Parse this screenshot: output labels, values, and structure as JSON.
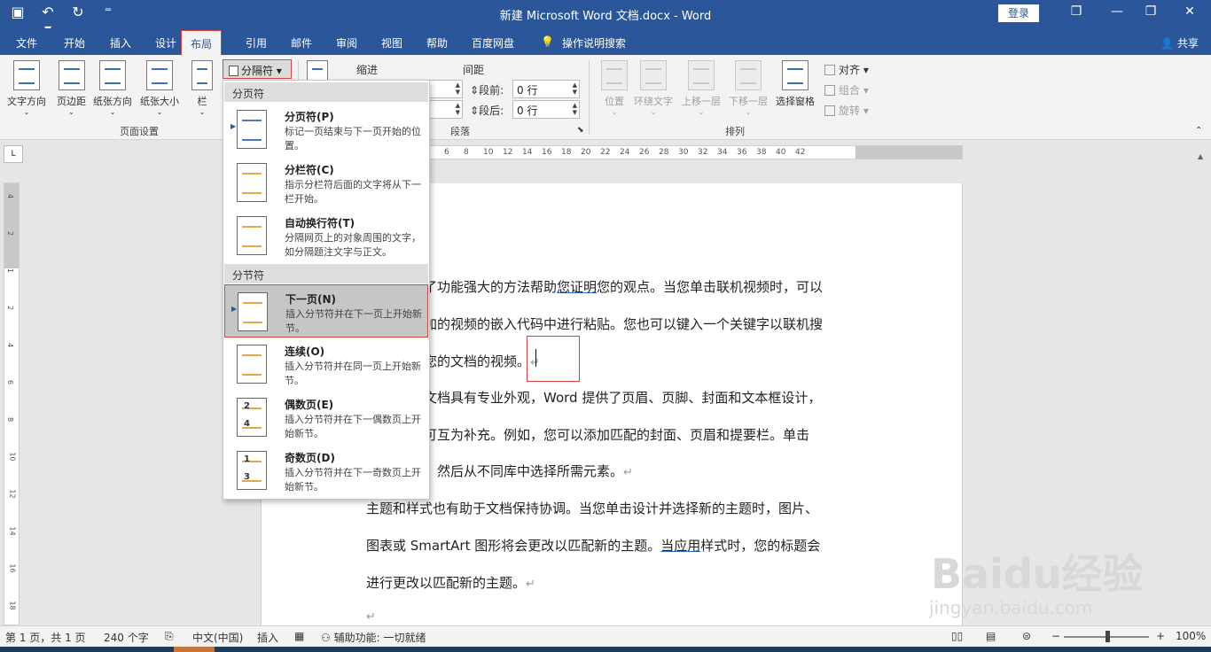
{
  "titlebar": {
    "title": "新建 Microsoft Word 文档.docx  -  Word",
    "login": "登录",
    "qat_icons": [
      "save-icon",
      "undo-icon",
      "redo-icon",
      "customize-icon"
    ],
    "save_glyph": "▣",
    "undo_glyph": "↶ ▾",
    "redo_glyph": "↻",
    "customize_glyph": "⁼",
    "restore_glyph": "❐",
    "minimize_glyph": "—",
    "maximize_glyph": "❐",
    "close_glyph": "✕"
  },
  "tabs": [
    "文件",
    "开始",
    "插入",
    "设计",
    "布局",
    "引用",
    "邮件",
    "审阅",
    "视图",
    "帮助",
    "百度网盘",
    "操作说明搜索"
  ],
  "active_tab": "布局",
  "share": "共享",
  "ribbon": {
    "page_setup": {
      "text_direction": "文字方向",
      "margins": "页边距",
      "orientation": "纸张方向",
      "size": "纸张大小",
      "columns": "栏",
      "breaks": "分隔符 ▾",
      "group_label": "页面设置"
    },
    "paragraph": {
      "indent_label": "缩进",
      "spacing_label": "间距",
      "before_label": "段前:",
      "after_label": "段后:",
      "before_value": "0 行",
      "after_value": "0 行",
      "group_label": "段落"
    },
    "arrange": {
      "position": "位置",
      "wrap_text": "环绕文字",
      "bring_forward": "上移一层",
      "send_backward": "下移一层",
      "selection_pane": "选择窗格",
      "align": "对齐 ▾",
      "group": "组合 ▾",
      "rotate": "旋转 ▾",
      "group_label": "排列"
    }
  },
  "breaks_menu": {
    "page_breaks_header": "分页符",
    "section_breaks_header": "分节符",
    "items": [
      {
        "title": "分页符(P)",
        "desc": "标记一页结束与下一页开始的位置。"
      },
      {
        "title": "分栏符(C)",
        "desc": "指示分栏符后面的文字将从下一栏开始。"
      },
      {
        "title": "自动换行符(T)",
        "desc": "分隔网页上的对象周围的文字，如分隔题注文字与正文。"
      },
      {
        "title": "下一页(N)",
        "desc": "插入分节符并在下一页上开始新节。"
      },
      {
        "title": "连续(O)",
        "desc": "插入分节符并在同一页上开始新节。"
      },
      {
        "title": "偶数页(E)",
        "desc": "插入分节符并在下一偶数页上开始新节。"
      },
      {
        "title": "奇数页(D)",
        "desc": "插入分节符并在下一奇数页上开始新节。"
      }
    ],
    "even_badges": [
      "2",
      "4"
    ],
    "odd_badges": [
      "1",
      "3"
    ]
  },
  "ruler": {
    "corner": "L",
    "h_ticks": [
      "6",
      "8",
      "10",
      "12",
      "14",
      "16",
      "18",
      "20",
      "22",
      "24",
      "26",
      "28",
      "30",
      "32",
      "34",
      "36",
      "38",
      "40",
      "42"
    ],
    "v_ticks": [
      "4",
      "2",
      "1",
      "2",
      "4",
      "6",
      "8",
      "10",
      "12",
      "14",
      "16",
      "18"
    ]
  },
  "document": {
    "lines": [
      {
        "pre": "了功能强大的方法帮助",
        "ul": "您证明",
        "post": "您的观点。当您单击联机视频时，可以"
      },
      {
        "pre": "加的视频的嵌入代码中进行粘贴。您也可以键入一个关键字以联机搜",
        "ul": "",
        "post": ""
      },
      {
        "pre": "您的文档的视频。",
        "ul": "",
        "post": ""
      },
      {
        "pre": "文档具有专业外观，Word 提供了页眉、页脚、封面和文本框设计，",
        "ul": "",
        "post": ""
      },
      {
        "pre": "可互为补充。例如，您可以添加匹配的封面、页眉和提要栏。单击",
        "ul": "",
        "post": ""
      },
      {
        "pre": "，然后从不同库中选择所需元素。",
        "ul": "",
        "post": ""
      },
      {
        "pre": "主题和样式也有助于文档保持协调。当您单击设计并选择新的主题时，图片、",
        "ul": "",
        "post": ""
      },
      {
        "pre": "图表或 SmartArt 图形将会更改以匹配新的主题。",
        "ul": "当应用",
        "post": "样式时，您的标题会"
      },
      {
        "pre": "进行更改以匹配新的主题。",
        "ul": "",
        "post": ""
      }
    ],
    "para_mark": "↵"
  },
  "statusbar": {
    "page": "第 1 页，共 1 页",
    "words": "240 个字",
    "language": "中文(中国)",
    "mode": "插入",
    "accessibility": "辅助功能: 一切就绪",
    "zoom": "100%",
    "zoom_minus": "−",
    "zoom_plus": "+"
  },
  "watermark": {
    "main": "Baidu经验",
    "sub": "jingyan.baidu.com"
  },
  "colors": {
    "brand": "#2b579a",
    "highlight": "#e04040"
  }
}
